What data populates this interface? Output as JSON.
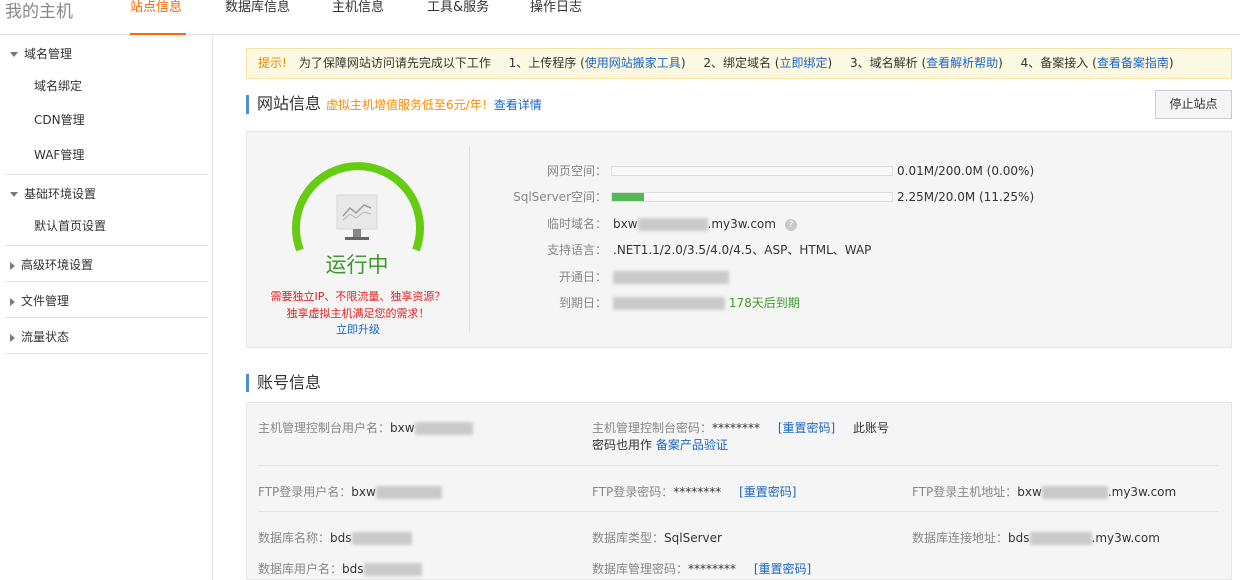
{
  "brand": "我的主机",
  "nav_tabs": [
    "站点信息",
    "数据库信息",
    "主机信息",
    "工具&服务",
    "操作日志"
  ],
  "sidebar": {
    "domain": {
      "title": "域名管理",
      "items": [
        "域名绑定",
        "CDN管理",
        "WAF管理"
      ]
    },
    "basic": {
      "title": "基础环境设置",
      "items": [
        "默认首页设置"
      ]
    },
    "advanced": "高级环境设置",
    "files": "文件管理",
    "traffic": "流量状态"
  },
  "tip": {
    "label": "提示!",
    "intro": "为了保障网站访问请先完成以下工作",
    "s1": "1、上传程序 (",
    "s1_link": "使用网站搬家工具",
    "s2": "2、绑定域名 (",
    "s2_link": "立即绑定",
    "s3": "3、域名解析 (",
    "s3_link": "查看解析帮助",
    "s4": "4、备案接入 (",
    "s4_link": "查看备案指南",
    "close": ")"
  },
  "site": {
    "title": "网站信息",
    "promo": "虚拟主机增值服务低至6元/年！",
    "promo_link": "查看详情",
    "stop_button": "停止站点",
    "status": "运行中",
    "upsell_1": "需要独立IP、不限流量、独享资源？",
    "upsell_2": "独享虚拟主机满足您的需求！",
    "upgrade": "立即升级",
    "web_space_label": "网页空间：",
    "web_space_value": "0.01M/200.0M (0.00%)",
    "web_space_fraction": 0.0,
    "sql_space_label": "SqlServer空间：",
    "sql_space_value": "2.25M/20.0M (11.25%)",
    "sql_space_fraction": 0.1125,
    "temp_domain_label": "临时域名：",
    "temp_domain_prefix": "bxw",
    "temp_domain_suffix": ".my3w.com",
    "lang_label": "支持语言：",
    "lang_value": ".NET1.1/2.0/3.5/4.0/4.5、ASP、HTML、WAP",
    "open_label": "开通日：",
    "expire_label": "到期日：",
    "expire_days": "178天后到期"
  },
  "account": {
    "title": "账号信息",
    "ctrl_user_label": "主机管理控制台用户名：",
    "ctrl_user_value": "bxw",
    "ctrl_pwd_label": "主机管理控制台密码：",
    "ctrl_pwd_value": "********",
    "reset": "[重置密码]",
    "ctrl_note": "此账号",
    "ctrl_note2": "密码也用作",
    "ctrl_note_link": "备案产品验证",
    "ftp_user_label": "FTP登录用户名：",
    "ftp_user_value": "bxw",
    "ftp_pwd_label": "FTP登录密码：",
    "ftp_pwd_value": "********",
    "ftp_host_label": "FTP登录主机地址：",
    "ftp_host_prefix": "bxw",
    "ftp_host_suffix": ".my3w.com",
    "db_name_label": "数据库名称：",
    "db_name_value": "bds",
    "db_type_label": "数据库类型：",
    "db_type_value": "SqlServer",
    "db_host_label": "数据库连接地址：",
    "db_host_prefix": "bds",
    "db_host_suffix": ".my3w.com",
    "db_user_label": "数据库用户名：",
    "db_user_value": "bds",
    "db_pwd_label": "数据库管理密码：",
    "db_pwd_value": "********"
  },
  "colors": {
    "accent": "#ff6600",
    "link": "#1a66c8",
    "running": "#3c9a2a",
    "gauge": "#66cc11"
  }
}
